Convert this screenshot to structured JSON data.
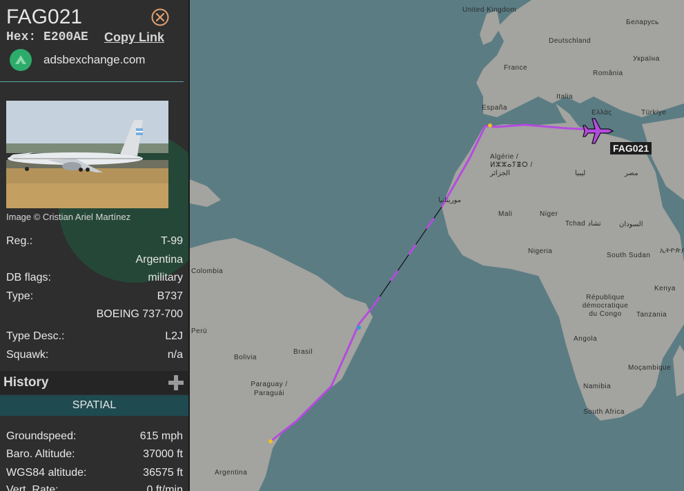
{
  "sidebar": {
    "callsign": "FAG021",
    "hex_label": "Hex:",
    "hex_value": "E200AE",
    "copy_link": "Copy Link",
    "source": "adsbexchange.com",
    "photo_credit": "Image © Cristian Ariel Martínez",
    "details": [
      {
        "label": "Reg.:",
        "value": "T-99"
      },
      {
        "label": "",
        "value": "Argentina"
      },
      {
        "label": "DB flags:",
        "value": "military"
      },
      {
        "label": "Type:",
        "value": "B737"
      },
      {
        "label": "",
        "value": "BOEING 737-700"
      },
      {
        "label": "Type Desc.:",
        "value": "L2J"
      },
      {
        "label": "Squawk:",
        "value": "n/a"
      }
    ],
    "history_title": "History",
    "spatial_label": "SPATIAL",
    "spatial_rows": [
      {
        "label": "Groundspeed:",
        "value": "615 mph"
      },
      {
        "label": "Baro. Altitude:",
        "value": "37000 ft"
      },
      {
        "label": "WGS84 altitude:",
        "value": "36575 ft"
      },
      {
        "label": "Vert. Rate:",
        "value": "0 ft/min"
      }
    ]
  },
  "map": {
    "flight_label": "FAG021",
    "labels": [
      "United Kingdom",
      "Беларусь",
      "Deutschland",
      "Україна",
      "France",
      "România",
      "Italia",
      "España",
      "Ελλάς",
      "Türkiye",
      "Algérie / ⵍⵣⵣⴰⵢⴻⵔ / الجزائر",
      "ليبيا",
      "مصر",
      "موريتانيا",
      "Mali",
      "Niger",
      "Tchad تشاد",
      "السودان",
      "Nigeria",
      "South Sudan",
      "ኢትዮጵያ",
      "Kenya",
      "République démocratique du Congo",
      "Tanzania",
      "Angola",
      "Moçambique",
      "Namibia",
      "South Africa",
      "Colombia",
      "Perú",
      "Brasil",
      "Bolivia",
      "Paraguay / Paraguái",
      "Argentina"
    ],
    "colors": {
      "track": "#b44be0",
      "water": "#5b7c83",
      "land": "#a3a39f"
    }
  }
}
